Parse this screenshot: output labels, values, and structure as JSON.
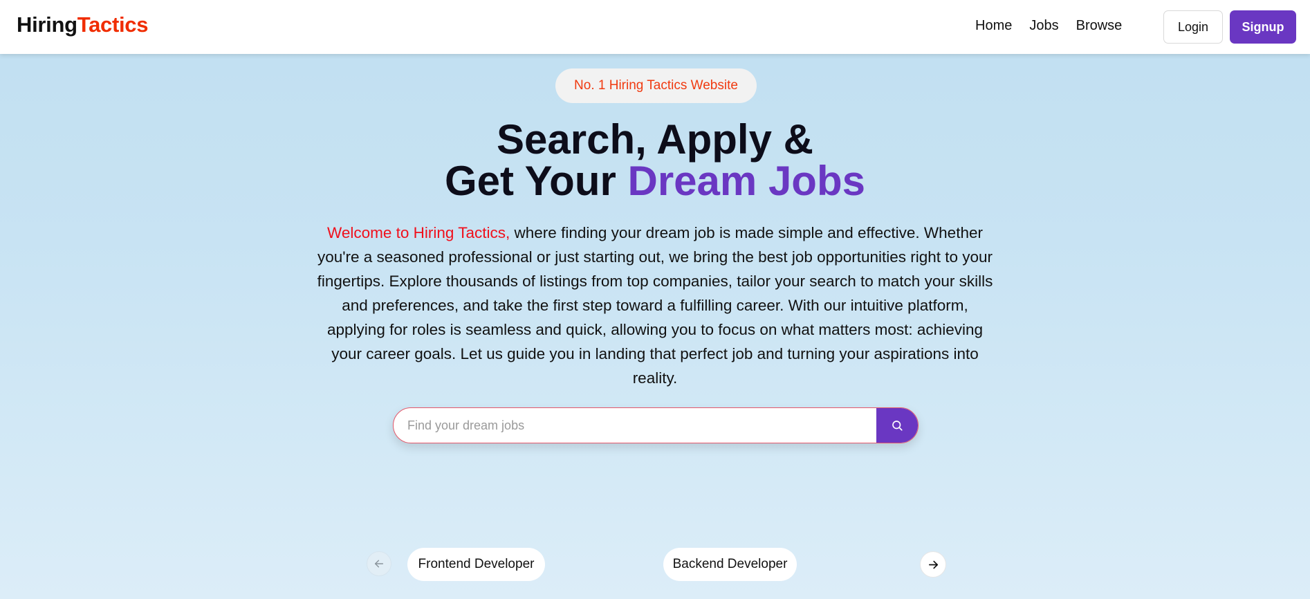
{
  "brand": {
    "name_part1": "Hiring",
    "name_part2": "Tactics",
    "accent_color": "#f02d00"
  },
  "nav": {
    "links": [
      "Home",
      "Jobs",
      "Browse"
    ],
    "login_label": "Login",
    "signup_label": "Signup"
  },
  "hero": {
    "badge": "No. 1 Hiring Tactics Website",
    "headline_line1": "Search, Apply &",
    "headline_line2_prefix": "Get Your ",
    "headline_line2_accent": "Dream Jobs",
    "intro_lead": "Welcome to Hiring Tactics,",
    "intro_body": " where finding your dream job is made simple and effective. Whether you're a seasoned professional or just starting out, we bring the best job opportunities right to your fingertips. Explore thousands of listings from top companies, tailor your search to match your skills and preferences, and take the first step toward a fulfilling career. With our intuitive platform, applying for roles is seamless and quick, allowing you to focus on what matters most: achieving your career goals. Let us guide you in landing that perfect job and turning your aspirations into reality."
  },
  "search": {
    "placeholder": "Find your dream jobs",
    "value": "",
    "icon": "search-icon"
  },
  "carousel": {
    "prev_icon": "arrow-left-icon",
    "next_icon": "arrow-right-icon",
    "items": [
      "Frontend Developer",
      "Backend Developer"
    ]
  },
  "colors": {
    "primary": "#6a37c2",
    "highlight_red": "#f0101c",
    "badge_text": "#f03a10"
  }
}
